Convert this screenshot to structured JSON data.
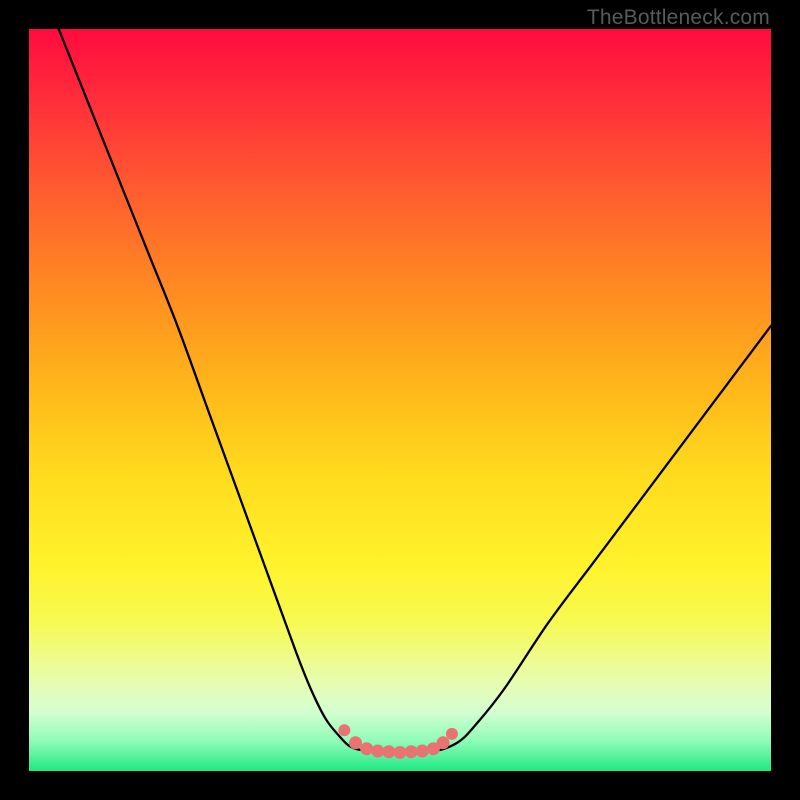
{
  "attribution": {
    "text": "TheBottleneck.com"
  },
  "colors": {
    "frame": "#000000",
    "curve_stroke": "#000000",
    "marker_fill": "#e97373",
    "marker_stroke": "#d65f5f"
  },
  "chart_data": {
    "type": "line",
    "title": "",
    "xlabel": "",
    "ylabel": "",
    "xlim": [
      0,
      100
    ],
    "ylim": [
      0,
      100
    ],
    "note": "No axis ticks, labels, or legend are rendered. Values are estimated percentages of the plot area (x left→right, y bottom→top).",
    "series": [
      {
        "name": "left-curve",
        "x": [
          4,
          8,
          12,
          16,
          20,
          24,
          28,
          32,
          36,
          38,
          40,
          42,
          43,
          44,
          45
        ],
        "y": [
          100,
          90,
          80,
          70,
          60,
          49,
          38,
          27,
          16,
          11,
          7,
          4.5,
          3.5,
          3,
          2.8
        ]
      },
      {
        "name": "valley-floor",
        "x": [
          45,
          47,
          49,
          51,
          53,
          55
        ],
        "y": [
          2.8,
          2.6,
          2.5,
          2.5,
          2.6,
          2.8
        ]
      },
      {
        "name": "right-curve",
        "x": [
          55,
          56,
          58,
          60,
          64,
          70,
          76,
          82,
          88,
          94,
          100
        ],
        "y": [
          2.8,
          3,
          4,
          6,
          11,
          20,
          28,
          36,
          44,
          52,
          60
        ]
      }
    ],
    "markers": {
      "name": "valley-markers",
      "x": [
        42.5,
        44,
        45.5,
        47,
        48.5,
        50,
        51.5,
        53,
        54.5,
        55.8,
        57
      ],
      "y": [
        5.5,
        3.8,
        3.0,
        2.7,
        2.6,
        2.5,
        2.6,
        2.7,
        3.0,
        3.8,
        5.0
      ],
      "r": [
        6,
        6.5,
        6.5,
        6.5,
        6.5,
        6.5,
        6.5,
        6.5,
        6.5,
        6.5,
        6
      ]
    }
  }
}
